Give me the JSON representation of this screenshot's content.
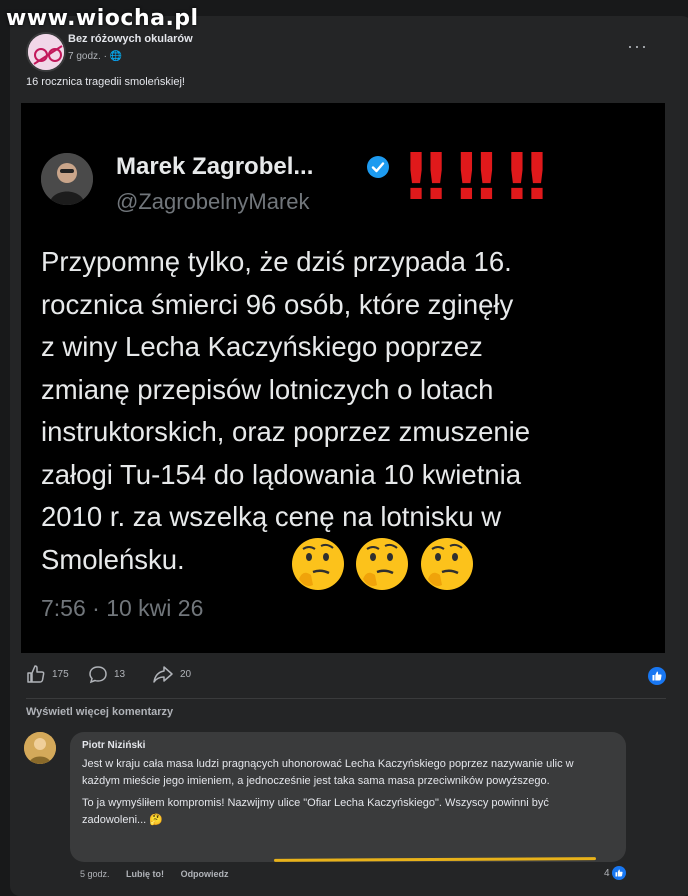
{
  "watermark": "www.wiocha.pl",
  "post": {
    "page_name": "Bez różowych okularów",
    "time": "7 godz.",
    "more": "···",
    "text": "16 rocznica tragedii smoleńskiej!"
  },
  "tweet": {
    "name": "Marek Zagrobel...",
    "handle": "@ZagrobelnyMarek",
    "marks": "‼ ‼ ‼",
    "lines": [
      "Przypomnę tylko, że dziś przypada 16.",
      "rocznica śmierci 96 osób, które zginęły",
      "z winy Lecha Kaczyńskiego poprzez",
      "zmianę przepisów lotniczych o lotach",
      "instruktorskich, oraz poprzez zmuszenie",
      "załogi Tu-154 do lądowania 10 kwietnia",
      "2010 r. za wszelką cenę na lotnisku w",
      "Smoleńsku."
    ],
    "emojis": "🤔 🤔 🤔",
    "timestamp": "7:56 · 10 kwi 26"
  },
  "actions": {
    "likes": "175",
    "comments": "13",
    "shares": "20"
  },
  "comments": {
    "more_label": "Wyświetl więcej komentarzy",
    "author": "Piotr Niziński",
    "p1": "Jest w kraju cała masa ludzi pragnących uhonorować Lecha Kaczyńskiego poprzez nazywanie ulic w każdym mieście jego imieniem, a jednocześnie jest taka sama masa przeciwników powyższego.",
    "p2": "To ja wymyśliłem kompromis! Nazwijmy ulice \"Ofiar Lecha Kaczyńskiego\". Wszyscy powinni być zadowoleni...",
    "emoji": "🤔",
    "time": "5 godz.",
    "like_label": "Lubię to!",
    "reply_label": "Odpowiedz",
    "reactions": "4"
  },
  "colors": {
    "accent": "#1877f2",
    "marks": "#e0191b",
    "underline": "#e8b21a"
  }
}
